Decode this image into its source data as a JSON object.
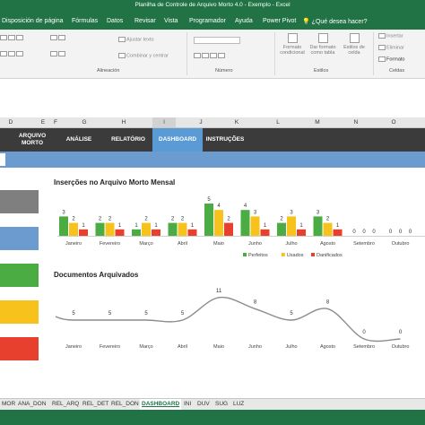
{
  "window": {
    "title": "Planilha de Controle de Arquivo Morto 4.0 - Exemplo  -  Excel"
  },
  "ribbon_tabs": [
    "Disposición de página",
    "Fórmulas",
    "Datos",
    "Revisar",
    "Vista",
    "Programador",
    "Ayuda",
    "Power Pivot",
    "¿Qué desea hacer?"
  ],
  "ribbon": {
    "ajustar_texto": "Ajustar texto",
    "combinar": "Combinar y centrar",
    "alineacion_label": "Alineación",
    "numero_label": "Número",
    "formato_condicional": "Formato condicional",
    "dar_formato_tabla": "Dar formato como tabla",
    "estilos_celda": "Estilos de celda",
    "estilos_label": "Estilos",
    "insertar": "Insertar",
    "eliminar": "Eliminar",
    "formato": "Formato",
    "celdas_label": "Celdas"
  },
  "columns": [
    "D",
    "E",
    "F",
    "G",
    "H",
    "I",
    "J",
    "K",
    "L",
    "M",
    "N",
    "O"
  ],
  "nav": [
    {
      "label": "ARQUIVO MORTO",
      "active": false
    },
    {
      "label": "ANÁLISE",
      "active": false
    },
    {
      "label": "RELATÓRIO",
      "active": false
    },
    {
      "label": "DASHBOARD",
      "active": true
    },
    {
      "label": "INSTRUÇÕES",
      "active": false
    }
  ],
  "colors": {
    "perfeitos": "#4aac42",
    "usados": "#f7c21b",
    "danificados": "#e8402f",
    "nav_active": "#5b9bd5",
    "excel_green": "#217346"
  },
  "left_blocks": [
    "#7f7f7f",
    "#6c9ccf",
    "#4aac42",
    "#f7c21b",
    "#e8402f"
  ],
  "sheet_tabs": [
    "MOR",
    "ANA_DON",
    "REL_ARQ",
    "REL_DET",
    "REL_DON",
    "DASHBOARD",
    "INI",
    "DUV",
    "SUG",
    "LUZ"
  ],
  "chart_data": [
    {
      "type": "bar",
      "title": "Inserções no Arquivo Morto Mensal",
      "categories": [
        "Janeiro",
        "Fevereiro",
        "Março",
        "Abril",
        "Maio",
        "Junho",
        "Julho",
        "Agosto",
        "Setembro",
        "Outubro"
      ],
      "series": [
        {
          "name": "Perfeitos",
          "values": [
            3,
            2,
            1,
            2,
            5,
            4,
            2,
            3,
            0,
            0
          ]
        },
        {
          "name": "Usados",
          "values": [
            2,
            2,
            2,
            2,
            4,
            3,
            3,
            2,
            0,
            0
          ]
        },
        {
          "name": "Danificados",
          "values": [
            1,
            1,
            1,
            1,
            2,
            1,
            1,
            1,
            0,
            0
          ]
        }
      ],
      "legend": "bottom"
    },
    {
      "type": "line",
      "title": "Documentos Arquivados",
      "categories": [
        "Janeiro",
        "Fevereiro",
        "Março",
        "Abril",
        "Maio",
        "Junho",
        "Julho",
        "Agosto",
        "Setembro",
        "Outubro"
      ],
      "values": [
        5,
        5,
        5,
        5,
        11,
        8,
        5,
        8,
        0,
        0
      ]
    }
  ]
}
